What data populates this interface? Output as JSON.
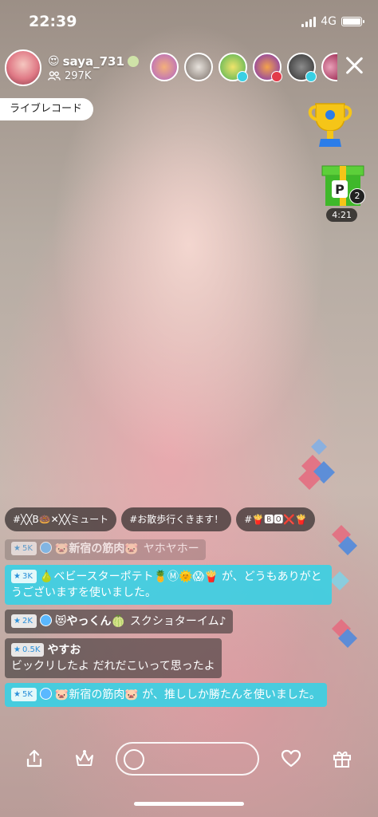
{
  "status_bar": {
    "time": "22:39",
    "network": "4G"
  },
  "host": {
    "username": "saya_731",
    "followers": "297K"
  },
  "live_record": "ライブレコード",
  "gift_box": {
    "count": "2",
    "timer": "4:21"
  },
  "tags": [
    "#╳╳B🍩✕╳╳ミュート",
    "#お散歩行くきます！",
    "#🍟🅱🅾❌🍟"
  ],
  "comments": [
    {
      "badge": "5K",
      "name": "🐷新宿の筋肉🐷",
      "text": "ヤホヤホー",
      "style": "faded"
    },
    {
      "badge": "3K",
      "name": "",
      "text": "🍐ベビースターポテト🍍Ⓜ🌞😱🍟 が、どうもありがとうございますを使いました。",
      "style": "cyan"
    },
    {
      "badge": "2K",
      "name": "😻やっくん🍈",
      "text": "スクショターイム♪",
      "style": "dark"
    },
    {
      "badge": "0.5K",
      "name": "やすお",
      "text": "ビックリしたよ だれだこいって思ったよ",
      "style": "dark"
    },
    {
      "badge": "5K",
      "name": "",
      "text": "🐷新宿の筋肉🐷 が、推ししか勝たんを使いました。",
      "style": "cyan"
    }
  ],
  "colors": {
    "accent_cyan": "#39d0e4",
    "badge_blue": "#2b90d9",
    "trophy_gold": "#f5c518"
  },
  "icons": [
    "share-icon",
    "crown-icon",
    "comment-icon",
    "heart-icon",
    "gift-icon",
    "close-icon",
    "trophy-icon"
  ]
}
